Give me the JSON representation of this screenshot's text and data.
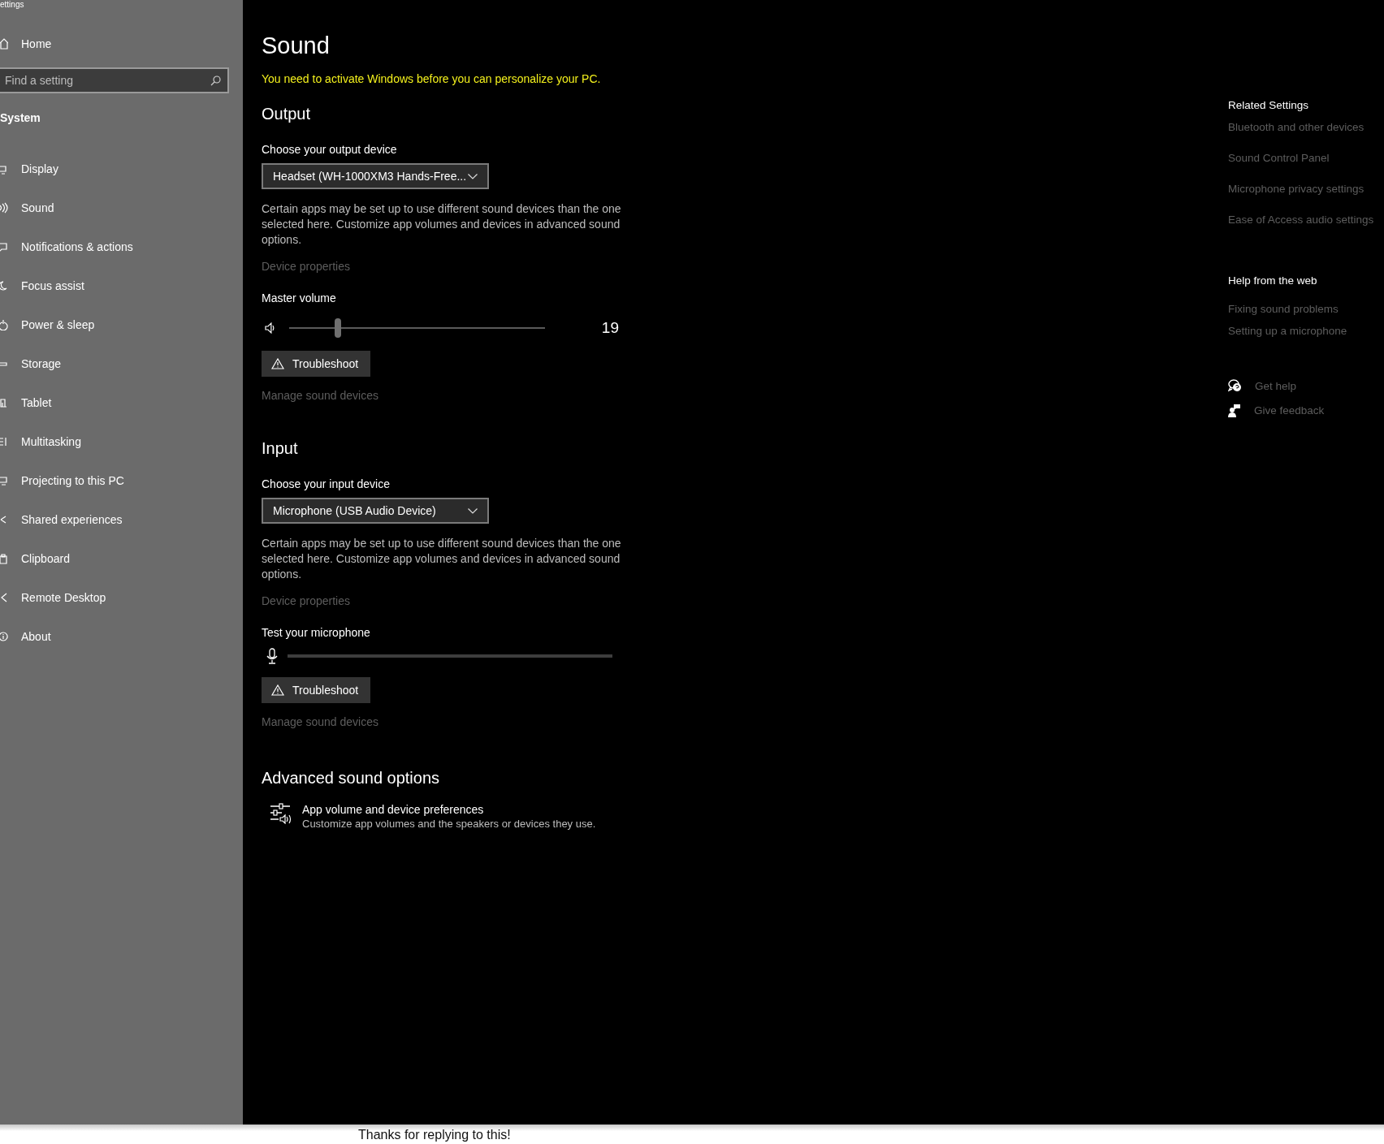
{
  "window": {
    "title": "ettings"
  },
  "sidebar": {
    "home": "Home",
    "search": {
      "placeholder": "Find a setting"
    },
    "section": "System",
    "items": [
      {
        "label": "Display"
      },
      {
        "label": "Sound"
      },
      {
        "label": "Notifications & actions"
      },
      {
        "label": "Focus assist"
      },
      {
        "label": "Power & sleep"
      },
      {
        "label": "Storage"
      },
      {
        "label": "Tablet"
      },
      {
        "label": "Multitasking"
      },
      {
        "label": "Projecting to this PC"
      },
      {
        "label": "Shared experiences"
      },
      {
        "label": "Clipboard"
      },
      {
        "label": "Remote Desktop"
      },
      {
        "label": "About"
      }
    ]
  },
  "page": {
    "title": "Sound",
    "warning": "You need to activate Windows before you can personalize your PC."
  },
  "output": {
    "heading": "Output",
    "device_label": "Choose your output device",
    "device": "Headset (WH-1000XM3 Hands-Free...",
    "description": "Certain apps may be set up to use different sound devices than the one selected here. Customize app volumes and devices in advanced sound options.",
    "properties_link": "Device properties",
    "volume_label": "Master volume",
    "volume": {
      "level": 0.19,
      "reading": "19"
    },
    "troubleshoot": "Troubleshoot",
    "manage_link": "Manage sound devices"
  },
  "input": {
    "heading": "Input",
    "device_label": "Choose your input device",
    "device": "Microphone (USB Audio Device)",
    "description": "Certain apps may be set up to use different sound devices than the one selected here. Customize app volumes and devices in advanced sound options.",
    "properties_link": "Device properties",
    "test_label": "Test your microphone",
    "troubleshoot": "Troubleshoot",
    "manage_link": "Manage sound devices"
  },
  "advanced": {
    "heading": "Advanced sound options",
    "item": {
      "title": "App volume and device preferences",
      "subtitle": "Customize app volumes and the speakers or devices they use."
    }
  },
  "related": {
    "heading": "Related Settings",
    "links": [
      "Bluetooth and other devices",
      "Sound Control Panel",
      "Microphone privacy settings",
      "Ease of Access audio settings"
    ]
  },
  "help": {
    "heading": "Help from the web",
    "links": [
      "Fixing sound problems",
      "Setting up a microphone"
    ]
  },
  "support": [
    {
      "kind": "help",
      "label": "Get help"
    },
    {
      "kind": "feedback",
      "label": "Give feedback"
    }
  ],
  "caption": "Thanks for replying to this!"
}
